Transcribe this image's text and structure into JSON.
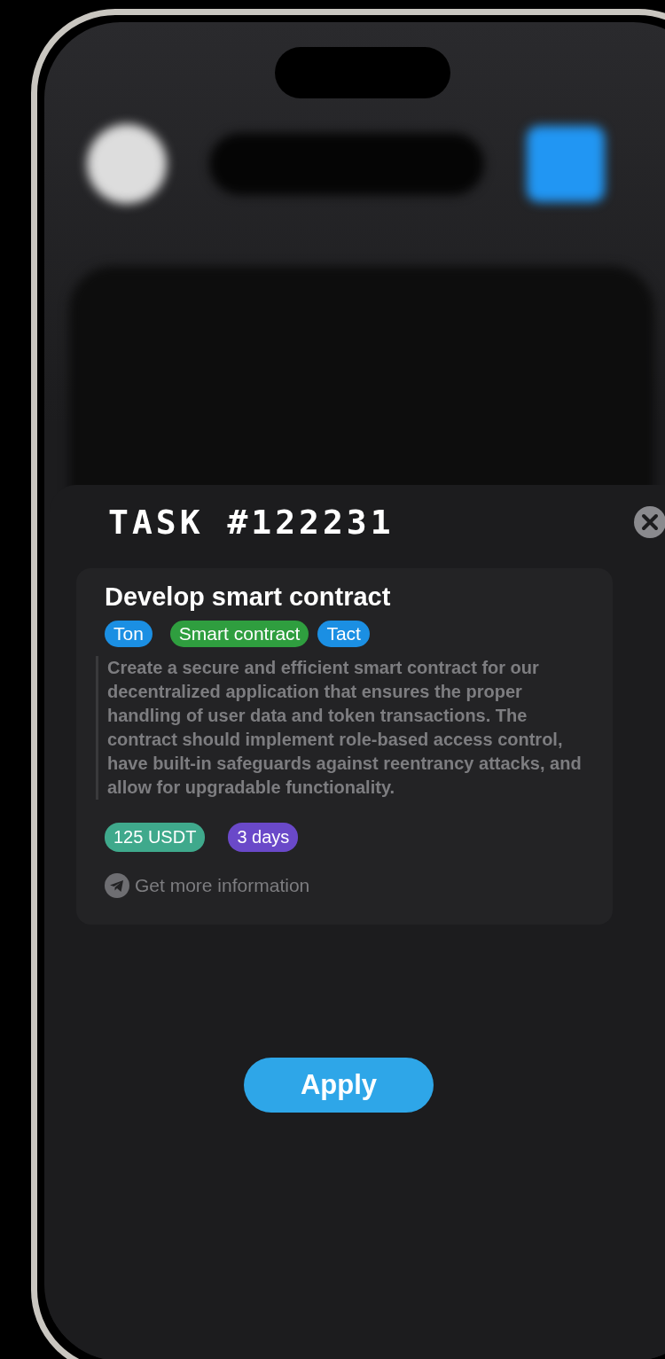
{
  "sheet": {
    "title": "TASK #122231",
    "task": {
      "title": "Develop smart contract",
      "tags": [
        {
          "label": "Ton",
          "color": "#1b8fe3"
        },
        {
          "label": "Smart contract",
          "color": "#2f9e3f"
        },
        {
          "label": "Tact",
          "color": "#1b8fe3"
        }
      ],
      "description": "Create a secure and efficient smart contract for our decentralized application that ensures the proper handling of user data and token transactions. The contract should implement role-based access control, have built-in safeguards against reentrancy attacks, and allow for upgradable functionality.",
      "badges": [
        {
          "label": "125 USDT",
          "color": "#3fa98c"
        },
        {
          "label": "3 days",
          "color": "#6a49c9"
        }
      ],
      "info_link": "Get more information"
    },
    "apply_button": "Apply"
  }
}
